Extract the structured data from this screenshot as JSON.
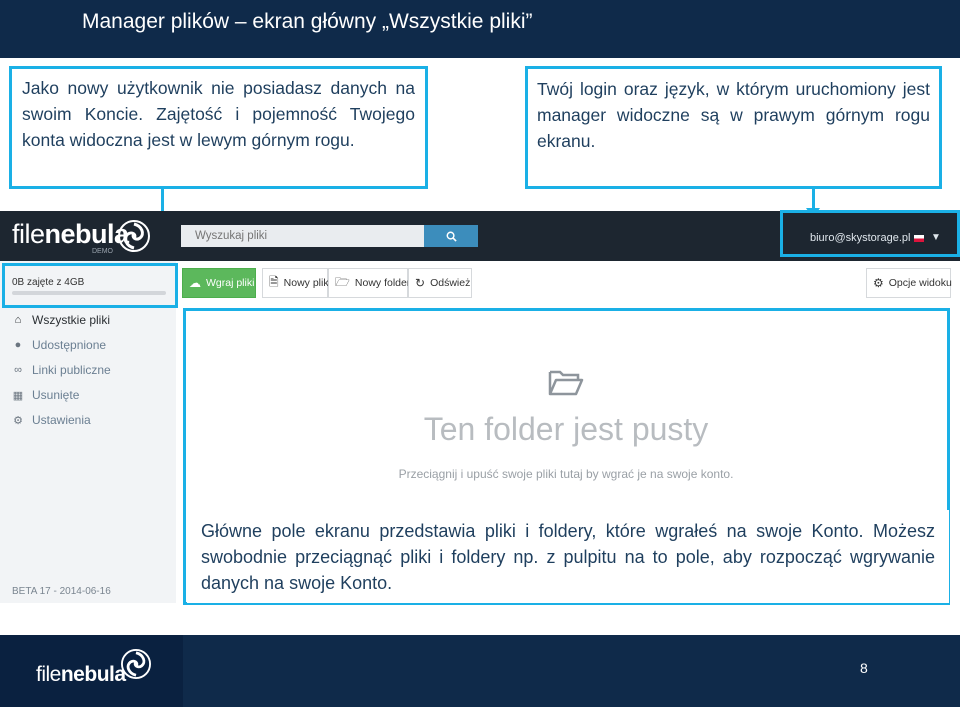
{
  "slide": {
    "title": "Manager plików – ekran główny „Wszystkie pliki”",
    "page_number": "8"
  },
  "callouts": {
    "left": "Jako nowy użytkownik nie posiadasz danych na swoim Koncie. Zajętość i pojemność Twojego konta widoczna jest w lewym górnym rogu.",
    "right": "Twój login oraz język, w którym uruchomiony jest manager widoczne są w prawym górnym rogu ekranu.",
    "bottom": "Główne pole ekranu przedstawia pliki i foldery, które wgrałeś na swoje Konto. Możesz swobodnie przeciągnąć pliki i foldery np. z pulpitu na to pole, aby rozpocząć wgrywanie danych na swoje Konto."
  },
  "app": {
    "logo": {
      "part1": "file",
      "part2": "nebula",
      "demo": "DEMO"
    },
    "search": {
      "placeholder": "Wyszukaj pliki",
      "icon": "search-icon"
    },
    "user": {
      "email": "biuro@skystorage.pl",
      "language_flag": "flag-pl-icon"
    },
    "quota": {
      "text": "0B zajęte z 4GB",
      "used_fraction": 0
    },
    "sidebar": {
      "items": [
        {
          "label": "Wszystkie pliki",
          "icon": "home-icon",
          "active": true
        },
        {
          "label": "Udostępnione",
          "icon": "users-icon",
          "active": false
        },
        {
          "label": "Linki publiczne",
          "icon": "link-icon",
          "active": false
        },
        {
          "label": "Usunięte",
          "icon": "trash-icon",
          "active": false
        },
        {
          "label": "Ustawienia",
          "icon": "gear-icon",
          "active": false
        }
      ],
      "version": "BETA 17 - 2014-06-16"
    },
    "toolbar": {
      "upload": "Wgraj pliki",
      "new_file": "Nowy plik",
      "new_folder": "Nowy folder",
      "refresh": "Odśwież",
      "view_options": "Opcje widoku"
    },
    "empty": {
      "title": "Ten folder jest pusty",
      "subtitle": "Przeciągnij i upuść swoje pliki tutaj by wgrać je na swoje konto."
    }
  },
  "footer": {
    "logo_part1": "file",
    "logo_part2": "nebula"
  },
  "colors": {
    "slide_navy": "#0f2a4a",
    "callout_border": "#1ab0e6",
    "app_topbar": "#1d2630",
    "upload_green": "#5cb85c",
    "search_blue": "#3c8dbc"
  }
}
